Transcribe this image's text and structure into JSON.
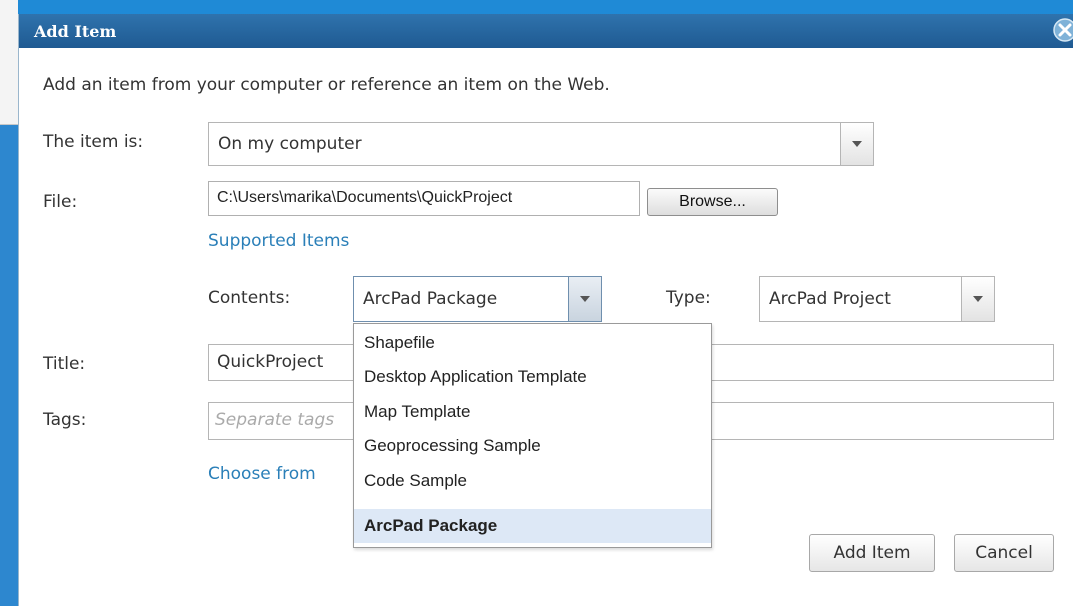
{
  "dialog": {
    "title": "Add Item",
    "intro": "Add an item from your computer or reference an item on the Web."
  },
  "form": {
    "item_is_label": "The item is:",
    "item_is_value": "On my computer",
    "file_label": "File:",
    "file_value": "C:\\Users\\marika\\Documents\\QuickProject",
    "browse_label": "Browse...",
    "supported_items_link": "Supported Items",
    "contents_label": "Contents:",
    "contents_value": "ArcPad Package",
    "type_label": "Type:",
    "type_value": "ArcPad Project",
    "title_label": "Title:",
    "title_value": "QuickProject",
    "tags_label": "Tags:",
    "tags_placeholder": "Separate tags",
    "choose_link": "Choose from"
  },
  "dropdown": {
    "options": [
      "Shapefile",
      "Desktop Application Template",
      "Map Template",
      "Geoprocessing Sample",
      "Code Sample",
      "ArcPad Package"
    ],
    "selected": "ArcPad Package"
  },
  "buttons": {
    "add_item": "Add Item",
    "cancel": "Cancel"
  },
  "icons": {
    "close": "close-icon",
    "dropdown_arrow": "chevron-down-icon"
  },
  "colors": {
    "titlebar": "#1f5a92",
    "link": "#2a7fb8",
    "selected_option": "#dde8f6",
    "background": "#2a7fc9"
  }
}
